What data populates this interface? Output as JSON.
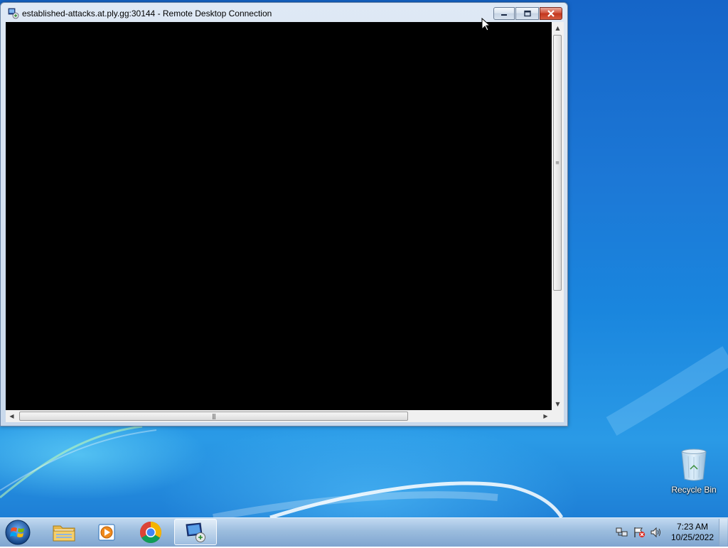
{
  "window": {
    "title": "established-attacks.at.ply.gg:30144 - Remote Desktop Connection",
    "minimize_icon": "minimize-icon",
    "maximize_icon": "restore-icon",
    "close_icon": "close-icon"
  },
  "desktop": {
    "icons": [
      {
        "label": "Recycle Bin",
        "icon": "recycle-bin-icon"
      }
    ]
  },
  "taskbar": {
    "start_icon": "windows-logo-icon",
    "pinned": [
      {
        "name": "Windows Explorer",
        "icon": "folder-icon"
      },
      {
        "name": "Windows Media Player",
        "icon": "media-player-icon"
      },
      {
        "name": "Google Chrome",
        "icon": "chrome-icon"
      },
      {
        "name": "Remote Desktop Connection",
        "icon": "remote-desktop-icon",
        "active": true
      }
    ],
    "tray": {
      "icons": [
        "network-icon",
        "action-center-flag-icon",
        "volume-icon"
      ],
      "time": "7:23 AM",
      "date": "10/25/2022"
    }
  },
  "colors": {
    "remote_screen": "#000000",
    "close_button": "#c2361e",
    "desktop_background": "#1a78d6"
  }
}
